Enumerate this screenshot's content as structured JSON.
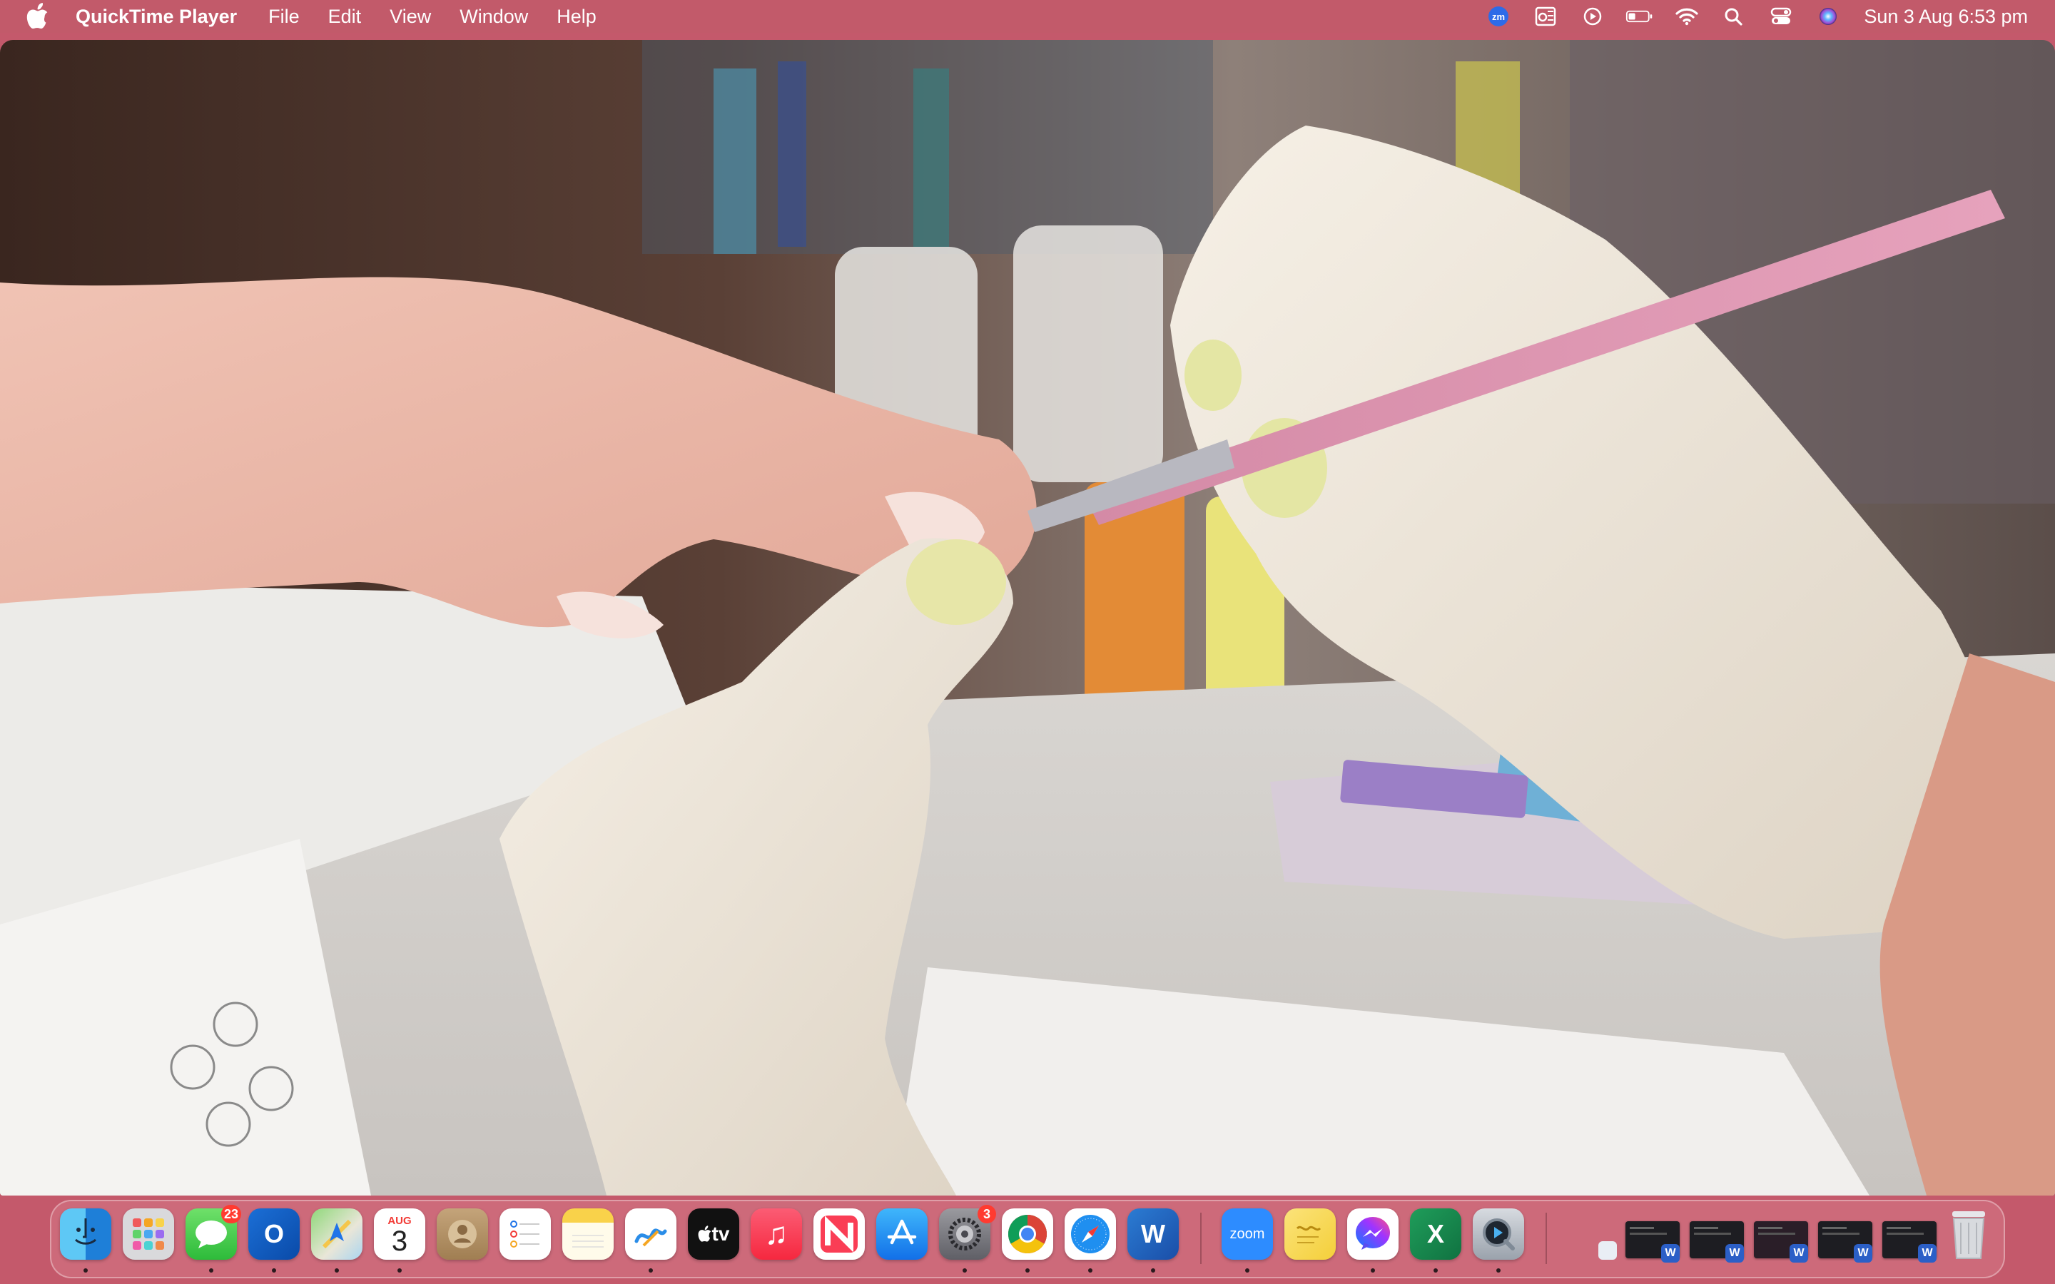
{
  "menubar": {
    "app_name": "QuickTime Player",
    "menus": [
      "File",
      "Edit",
      "View",
      "Window",
      "Help"
    ],
    "status_icons": [
      "zoom-icon",
      "outlook-menu-icon",
      "play-circle-icon",
      "battery-icon",
      "wifi-icon",
      "search-icon",
      "control-center-icon",
      "siri-icon"
    ],
    "zoom_label": "zm",
    "clock": "Sun 3 Aug  6:53 pm"
  },
  "video": {
    "description_icon": "video-frame"
  },
  "dock": {
    "apps": [
      {
        "name": "finder",
        "label": ""
      },
      {
        "name": "launchpad",
        "label": ""
      },
      {
        "name": "messages",
        "label": "",
        "badge": "23"
      },
      {
        "name": "outlook",
        "label": "O"
      },
      {
        "name": "maps",
        "label": ""
      },
      {
        "name": "calendar",
        "label": "3",
        "month": "AUG"
      },
      {
        "name": "contacts",
        "label": ""
      },
      {
        "name": "reminders",
        "label": ""
      },
      {
        "name": "notes",
        "label": ""
      },
      {
        "name": "freeform",
        "label": ""
      },
      {
        "name": "apple-tv",
        "label": "tv"
      },
      {
        "name": "music",
        "label": "♫"
      },
      {
        "name": "news",
        "label": ""
      },
      {
        "name": "app-store",
        "label": ""
      },
      {
        "name": "system-settings",
        "label": "",
        "badge": "3"
      },
      {
        "name": "chrome",
        "label": ""
      },
      {
        "name": "safari",
        "label": ""
      },
      {
        "name": "word",
        "label": "W"
      },
      {
        "name": "zoom",
        "label": "zoom"
      },
      {
        "name": "stickies",
        "label": ""
      },
      {
        "name": "messenger",
        "label": ""
      },
      {
        "name": "excel",
        "label": "X"
      },
      {
        "name": "quicktime",
        "label": ""
      }
    ],
    "minimized_badge": "W",
    "calendar_month": "AUG",
    "calendar_day": "3",
    "messages_badge": "23",
    "settings_badge": "3",
    "outlook_label": "O",
    "word_label": "W",
    "excel_label": "X",
    "zoom_label": "zoom",
    "tv_label": "tv"
  }
}
